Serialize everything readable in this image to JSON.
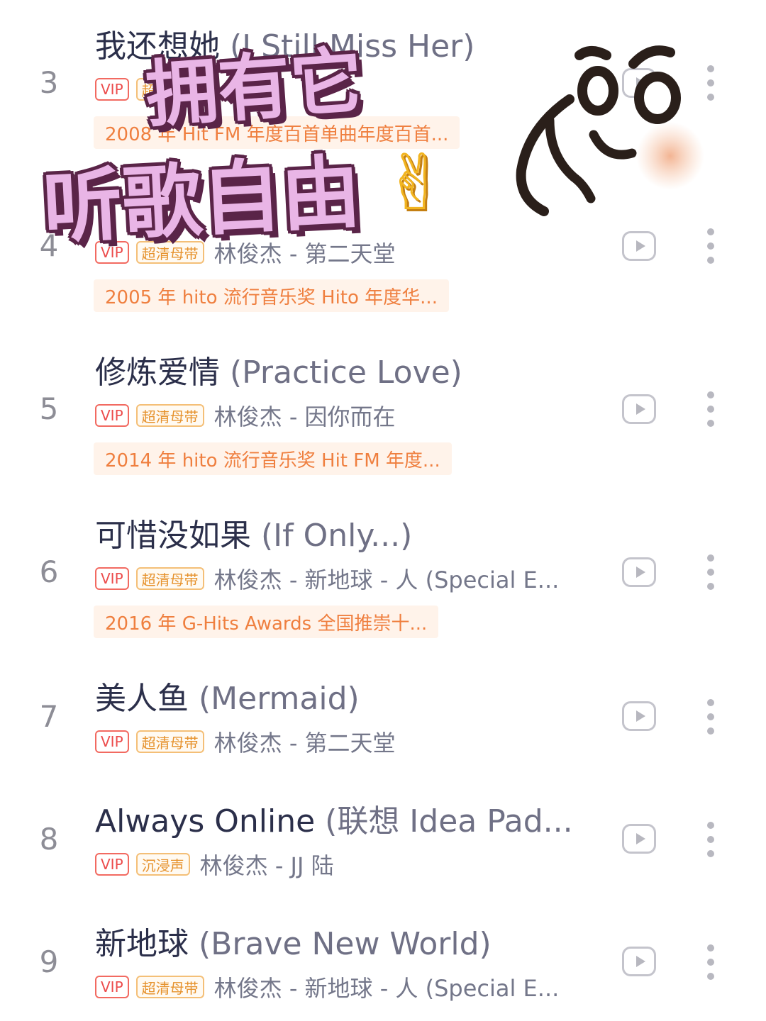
{
  "colors": {
    "vip": "#ec4c4c",
    "quality": "#e6922d",
    "award_text": "#ef7f3f",
    "award_bg": "#fff3ea",
    "title": "#2b2f4a",
    "subtitle": "#74778a",
    "sticker_fill": "#e9b5e6",
    "sticker_outline": "#5a2448"
  },
  "songs": [
    {
      "rank": "3",
      "title": "我还想她",
      "alt_title": "(I Still Miss Her)",
      "badges": [
        "VIP",
        "超清母带"
      ],
      "artist_album": "",
      "award": "2008 年 Hit FM 年度百首单曲年度百首..."
    },
    {
      "rank": "4",
      "title": "",
      "alt_title": "",
      "badges": [
        "VIP",
        "超清母带"
      ],
      "artist_album": "林俊杰 - 第二天堂",
      "award": "2005 年 hito 流行音乐奖 Hito 年度华..."
    },
    {
      "rank": "5",
      "title": "修炼爱情",
      "alt_title": "(Practice Love)",
      "badges": [
        "VIP",
        "超清母带"
      ],
      "artist_album": "林俊杰 - 因你而在",
      "award": "2014 年 hito 流行音乐奖 Hit FM 年度..."
    },
    {
      "rank": "6",
      "title": "可惜没如果",
      "alt_title": "(If Only...)",
      "badges": [
        "VIP",
        "超清母带"
      ],
      "artist_album": "林俊杰 - 新地球 - 人 (Special E...",
      "award": "2016 年 G-Hits Awards 全国推崇十..."
    },
    {
      "rank": "7",
      "title": "美人鱼",
      "alt_title": "(Mermaid)",
      "badges": [
        "VIP",
        "超清母带"
      ],
      "artist_album": "林俊杰 - 第二天堂",
      "award": ""
    },
    {
      "rank": "8",
      "title": "Always Online",
      "alt_title": "(联想 Idea Pad...",
      "badges": [
        "VIP",
        "沉浸声"
      ],
      "artist_album": "林俊杰 - JJ 陆",
      "award": ""
    },
    {
      "rank": "9",
      "title": "新地球",
      "alt_title": "(Brave New World)",
      "badges": [
        "VIP",
        "超清母带"
      ],
      "artist_album": "林俊杰 - 新地球 - 人 (Special E...",
      "award": ""
    }
  ],
  "overlay": {
    "line1": "拥有它",
    "line2": "听歌自由",
    "emoji": "✌"
  }
}
